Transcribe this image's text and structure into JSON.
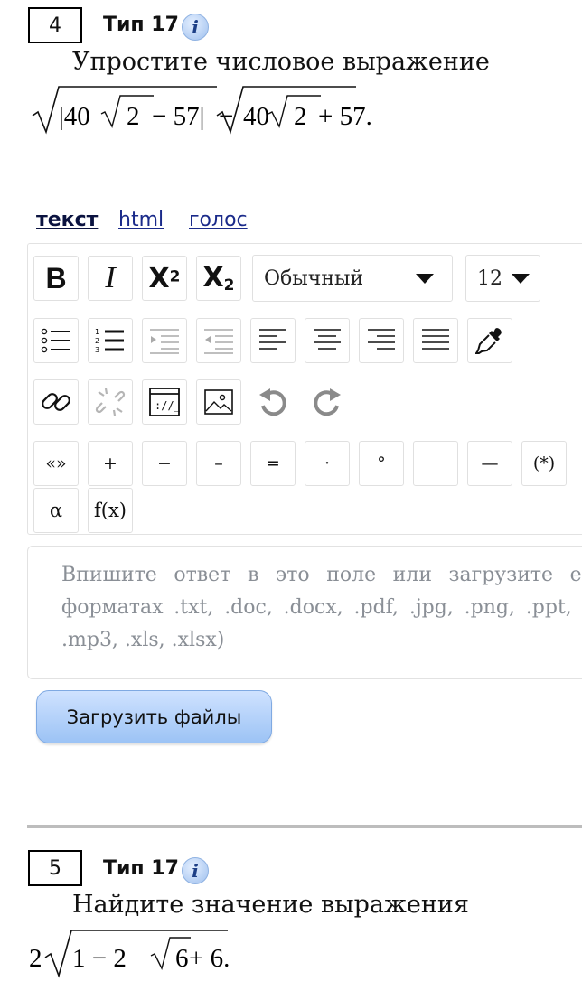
{
  "task4": {
    "number": "4",
    "type": "Тип 17",
    "info": "i",
    "prompt": "Упростите числовое выражение",
    "formula": {
      "abs_open": "|40",
      "inner1": "2",
      "minus57": " − 57|",
      "minus": "−",
      "coef": "40",
      "inner2": "2",
      "plus57": " + 57."
    }
  },
  "tabs": {
    "text": "текст",
    "html": "html",
    "voice": "голос"
  },
  "toolbar": {
    "bold": "B",
    "italic": "I",
    "superscript_base": "X",
    "superscript_sup": "2",
    "subscript_base": "X",
    "subscript_sub": "2",
    "format_value": "Обычный",
    "size_value": "12",
    "symbols": [
      "«»",
      "+",
      "−",
      "–",
      "=",
      "·",
      "°",
      "",
      "—",
      "(*)"
    ],
    "alpha": "α",
    "function": "f(x)"
  },
  "answer": {
    "placeholder": "Впишите ответ в это поле или загрузите его (в форматах .txt, .doc, .docx, .pdf, .jpg, .png, .ppt, .pptx, .mp3, .xls, .xlsx)"
  },
  "upload_button": "Загрузить файлы",
  "task5": {
    "number": "5",
    "type": "Тип 17",
    "info": "i",
    "prompt": "Найдите значение выражения",
    "formula": {
      "coef": "2",
      "one_minus_two": "1 − 2",
      "six": "6",
      "plus_six": " + 6."
    }
  }
}
